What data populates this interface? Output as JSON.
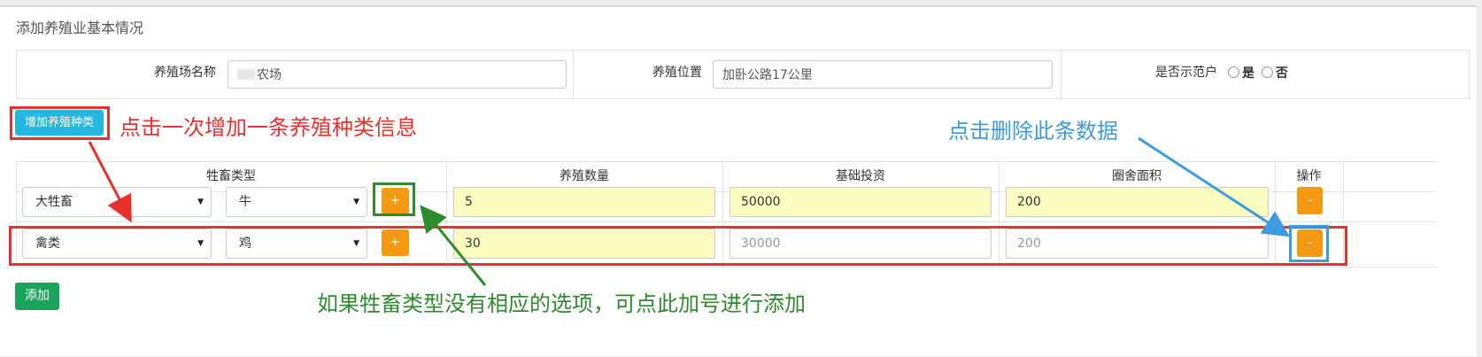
{
  "page": {
    "title": "添加养殖业基本情况"
  },
  "basic_info": {
    "farm_name_label": "养殖场名称",
    "farm_name_value": "农场",
    "location_label": "养殖位置",
    "location_value": "加卧公路17公里",
    "demo_label": "是否示范户",
    "radio_yes": "是",
    "radio_no": "否"
  },
  "add_species_button": "增加养殖种类",
  "table": {
    "headers": {
      "livestock_type": "牲畜类型",
      "quantity": "养殖数量",
      "investment": "基础投资",
      "area": "圈舍面积",
      "action": "操作"
    },
    "rows": [
      {
        "category": "大牲畜",
        "animal": "牛",
        "plus": "+",
        "quantity": "5",
        "investment": "50000",
        "area": "200",
        "minus": "-"
      },
      {
        "category": "禽类",
        "animal": "鸡",
        "plus": "+",
        "quantity": "30",
        "investment_placeholder": "30000",
        "area_placeholder": "200",
        "minus": "-"
      }
    ]
  },
  "submit_button": "添加",
  "annotations": {
    "add_once": "点击一次增加一条养殖种类信息",
    "delete_row": "点击删除此条数据",
    "plus_hint": "如果牲畜类型没有相应的选项，可点此加号进行添加"
  },
  "colors": {
    "red": "#e8302e",
    "green": "#2e8b2e",
    "blue": "#3d9be0"
  }
}
